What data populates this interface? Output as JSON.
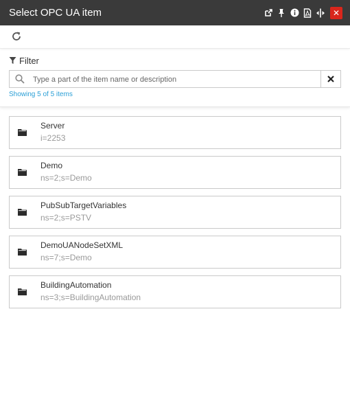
{
  "window": {
    "title": "Select OPC UA item",
    "buttons": [
      "popout-icon",
      "pin-icon",
      "info-icon",
      "pdf-icon",
      "resize-icon",
      "close-icon"
    ],
    "close_color": "#d9261c"
  },
  "toolbar": {
    "refresh_icon": "refresh-icon"
  },
  "filter": {
    "label": "Filter",
    "placeholder": "Type a part of the item name or description",
    "value": "",
    "showing": "Showing 5 of 5 items",
    "accent_color": "#2a9fd6"
  },
  "items": [
    {
      "name": "Server",
      "desc": "i=2253"
    },
    {
      "name": "Demo",
      "desc": "ns=2;s=Demo"
    },
    {
      "name": "PubSubTargetVariables",
      "desc": "ns=2;s=PSTV"
    },
    {
      "name": "DemoUANodeSetXML",
      "desc": "ns=7;s=Demo"
    },
    {
      "name": "BuildingAutomation",
      "desc": "ns=3;s=BuildingAutomation"
    }
  ]
}
